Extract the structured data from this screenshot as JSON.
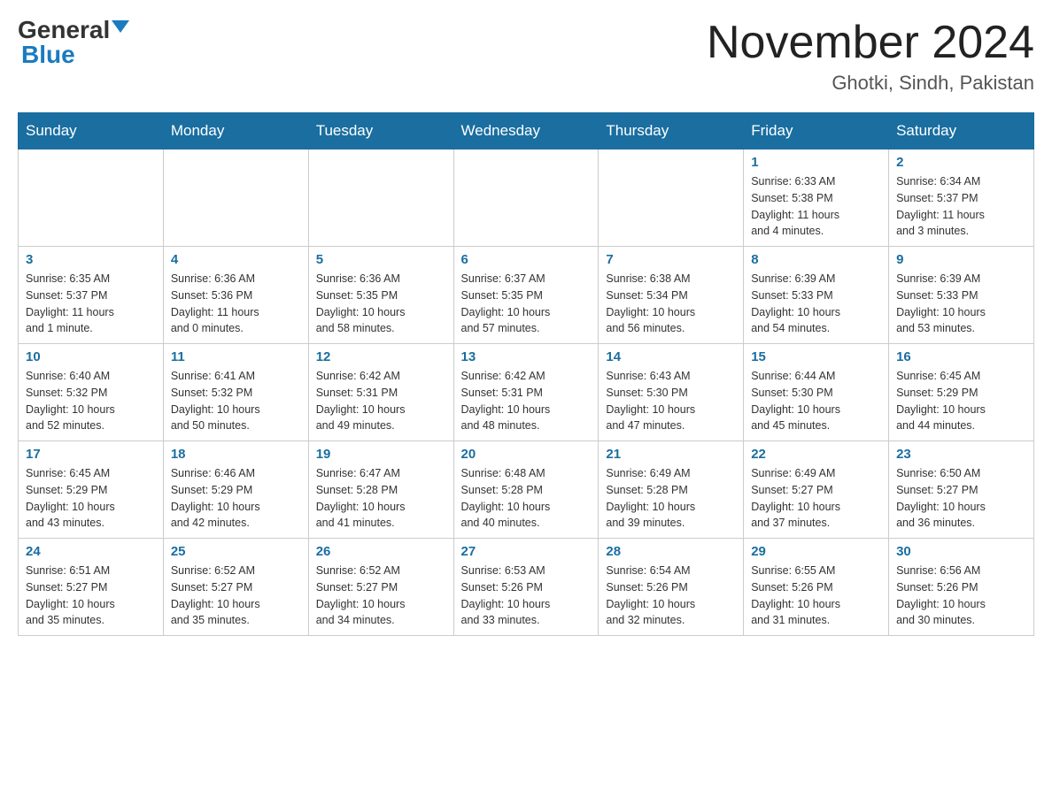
{
  "header": {
    "logo_general": "General",
    "logo_blue": "Blue",
    "month_year": "November 2024",
    "location": "Ghotki, Sindh, Pakistan"
  },
  "weekdays": [
    "Sunday",
    "Monday",
    "Tuesday",
    "Wednesday",
    "Thursday",
    "Friday",
    "Saturday"
  ],
  "weeks": [
    [
      {
        "day": "",
        "info": ""
      },
      {
        "day": "",
        "info": ""
      },
      {
        "day": "",
        "info": ""
      },
      {
        "day": "",
        "info": ""
      },
      {
        "day": "",
        "info": ""
      },
      {
        "day": "1",
        "info": "Sunrise: 6:33 AM\nSunset: 5:38 PM\nDaylight: 11 hours\nand 4 minutes."
      },
      {
        "day": "2",
        "info": "Sunrise: 6:34 AM\nSunset: 5:37 PM\nDaylight: 11 hours\nand 3 minutes."
      }
    ],
    [
      {
        "day": "3",
        "info": "Sunrise: 6:35 AM\nSunset: 5:37 PM\nDaylight: 11 hours\nand 1 minute."
      },
      {
        "day": "4",
        "info": "Sunrise: 6:36 AM\nSunset: 5:36 PM\nDaylight: 11 hours\nand 0 minutes."
      },
      {
        "day": "5",
        "info": "Sunrise: 6:36 AM\nSunset: 5:35 PM\nDaylight: 10 hours\nand 58 minutes."
      },
      {
        "day": "6",
        "info": "Sunrise: 6:37 AM\nSunset: 5:35 PM\nDaylight: 10 hours\nand 57 minutes."
      },
      {
        "day": "7",
        "info": "Sunrise: 6:38 AM\nSunset: 5:34 PM\nDaylight: 10 hours\nand 56 minutes."
      },
      {
        "day": "8",
        "info": "Sunrise: 6:39 AM\nSunset: 5:33 PM\nDaylight: 10 hours\nand 54 minutes."
      },
      {
        "day": "9",
        "info": "Sunrise: 6:39 AM\nSunset: 5:33 PM\nDaylight: 10 hours\nand 53 minutes."
      }
    ],
    [
      {
        "day": "10",
        "info": "Sunrise: 6:40 AM\nSunset: 5:32 PM\nDaylight: 10 hours\nand 52 minutes."
      },
      {
        "day": "11",
        "info": "Sunrise: 6:41 AM\nSunset: 5:32 PM\nDaylight: 10 hours\nand 50 minutes."
      },
      {
        "day": "12",
        "info": "Sunrise: 6:42 AM\nSunset: 5:31 PM\nDaylight: 10 hours\nand 49 minutes."
      },
      {
        "day": "13",
        "info": "Sunrise: 6:42 AM\nSunset: 5:31 PM\nDaylight: 10 hours\nand 48 minutes."
      },
      {
        "day": "14",
        "info": "Sunrise: 6:43 AM\nSunset: 5:30 PM\nDaylight: 10 hours\nand 47 minutes."
      },
      {
        "day": "15",
        "info": "Sunrise: 6:44 AM\nSunset: 5:30 PM\nDaylight: 10 hours\nand 45 minutes."
      },
      {
        "day": "16",
        "info": "Sunrise: 6:45 AM\nSunset: 5:29 PM\nDaylight: 10 hours\nand 44 minutes."
      }
    ],
    [
      {
        "day": "17",
        "info": "Sunrise: 6:45 AM\nSunset: 5:29 PM\nDaylight: 10 hours\nand 43 minutes."
      },
      {
        "day": "18",
        "info": "Sunrise: 6:46 AM\nSunset: 5:29 PM\nDaylight: 10 hours\nand 42 minutes."
      },
      {
        "day": "19",
        "info": "Sunrise: 6:47 AM\nSunset: 5:28 PM\nDaylight: 10 hours\nand 41 minutes."
      },
      {
        "day": "20",
        "info": "Sunrise: 6:48 AM\nSunset: 5:28 PM\nDaylight: 10 hours\nand 40 minutes."
      },
      {
        "day": "21",
        "info": "Sunrise: 6:49 AM\nSunset: 5:28 PM\nDaylight: 10 hours\nand 39 minutes."
      },
      {
        "day": "22",
        "info": "Sunrise: 6:49 AM\nSunset: 5:27 PM\nDaylight: 10 hours\nand 37 minutes."
      },
      {
        "day": "23",
        "info": "Sunrise: 6:50 AM\nSunset: 5:27 PM\nDaylight: 10 hours\nand 36 minutes."
      }
    ],
    [
      {
        "day": "24",
        "info": "Sunrise: 6:51 AM\nSunset: 5:27 PM\nDaylight: 10 hours\nand 35 minutes."
      },
      {
        "day": "25",
        "info": "Sunrise: 6:52 AM\nSunset: 5:27 PM\nDaylight: 10 hours\nand 35 minutes."
      },
      {
        "day": "26",
        "info": "Sunrise: 6:52 AM\nSunset: 5:27 PM\nDaylight: 10 hours\nand 34 minutes."
      },
      {
        "day": "27",
        "info": "Sunrise: 6:53 AM\nSunset: 5:26 PM\nDaylight: 10 hours\nand 33 minutes."
      },
      {
        "day": "28",
        "info": "Sunrise: 6:54 AM\nSunset: 5:26 PM\nDaylight: 10 hours\nand 32 minutes."
      },
      {
        "day": "29",
        "info": "Sunrise: 6:55 AM\nSunset: 5:26 PM\nDaylight: 10 hours\nand 31 minutes."
      },
      {
        "day": "30",
        "info": "Sunrise: 6:56 AM\nSunset: 5:26 PM\nDaylight: 10 hours\nand 30 minutes."
      }
    ]
  ]
}
